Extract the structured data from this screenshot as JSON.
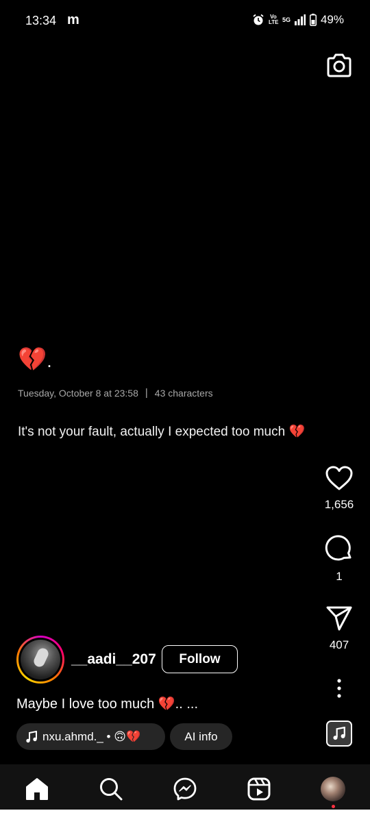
{
  "status_bar": {
    "time": "13:34",
    "app_indicator": "m",
    "network_lte": "Vo LTE",
    "network_5g": "5G",
    "battery": "49%"
  },
  "post": {
    "emoji_line": "💔",
    "emoji_suffix": ".",
    "date": "Tuesday, October 8 at 23:58",
    "separator": "|",
    "char_count": "43 characters",
    "body": "It's not your fault, actually I expected too much 💔"
  },
  "actions": {
    "likes": "1,656",
    "comments": "1",
    "shares": "407"
  },
  "author": {
    "username": "__aadi__207",
    "follow_label": "Follow",
    "caption": "Maybe I love too much 💔.. ..."
  },
  "chips": {
    "music": "nxu.ahmd._ • 🙃💔",
    "ai_info": "AI info"
  },
  "icons": {
    "camera": "camera-icon",
    "like": "heart-icon",
    "comment": "comment-icon",
    "share": "send-icon",
    "more": "more-vertical-icon",
    "music": "music-note-icon",
    "home": "home-icon",
    "search": "search-icon",
    "messenger": "messenger-icon",
    "reels": "reels-icon",
    "profile": "profile-avatar"
  },
  "colors": {
    "background": "#000000",
    "nav_background": "#121212",
    "chip_background": "#262626",
    "meta_text": "#a8a8a8",
    "notification_dot": "#ff3040"
  }
}
